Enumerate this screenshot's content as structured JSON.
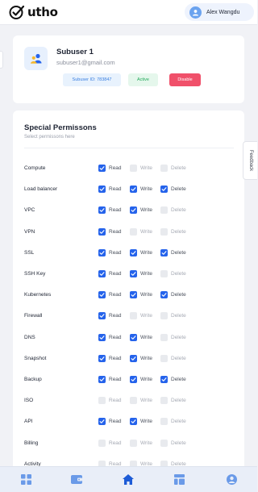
{
  "header": {
    "logo_text": "utho",
    "user_name": "Alex Wangdu"
  },
  "profile": {
    "name": "Subuser 1",
    "email": "subuser1@gmail.com",
    "id_badge": "Subuser ID: 783847",
    "status_badge": "Active",
    "disable_button": "Disable"
  },
  "permissions": {
    "title": "Special Permissons",
    "subtitle": "Select permissons here",
    "option_labels": {
      "read": "Read",
      "write": "Write",
      "delete": "Delete"
    },
    "rows": [
      {
        "resource": "Compute",
        "read": true,
        "write": false,
        "delete": false
      },
      {
        "resource": "Load balancer",
        "read": true,
        "write": true,
        "delete": true
      },
      {
        "resource": "VPC",
        "read": true,
        "write": true,
        "delete": false
      },
      {
        "resource": "VPN",
        "read": true,
        "write": false,
        "delete": false
      },
      {
        "resource": "SSL",
        "read": true,
        "write": true,
        "delete": true
      },
      {
        "resource": "SSH Key",
        "read": true,
        "write": true,
        "delete": false
      },
      {
        "resource": "Kubernetes",
        "read": true,
        "write": true,
        "delete": true
      },
      {
        "resource": "Firewall",
        "read": true,
        "write": false,
        "delete": false
      },
      {
        "resource": "DNS",
        "read": true,
        "write": true,
        "delete": false
      },
      {
        "resource": "Snapshot",
        "read": true,
        "write": true,
        "delete": false
      },
      {
        "resource": "Backup",
        "read": true,
        "write": true,
        "delete": true
      },
      {
        "resource": "ISO",
        "read": false,
        "write": false,
        "delete": false
      },
      {
        "resource": "API",
        "read": true,
        "write": true,
        "delete": false
      },
      {
        "resource": "Billing",
        "read": false,
        "write": false,
        "delete": false
      },
      {
        "resource": "Activity",
        "read": false,
        "write": false,
        "delete": false
      }
    ]
  },
  "feedback_tab": "Feedback",
  "bottom_nav": [
    {
      "icon": "dashboard-grid-icon"
    },
    {
      "icon": "wallet-icon"
    },
    {
      "icon": "home-icon",
      "active": true
    },
    {
      "icon": "layout-panel-icon"
    },
    {
      "icon": "user-profile-icon"
    }
  ],
  "colors": {
    "accent": "#2563eb",
    "nav_active": "#1d5bd6",
    "nav_inactive": "#6a9ae8",
    "active_badge_text": "#23a85a",
    "disable_button_bg": "#f0506a"
  }
}
